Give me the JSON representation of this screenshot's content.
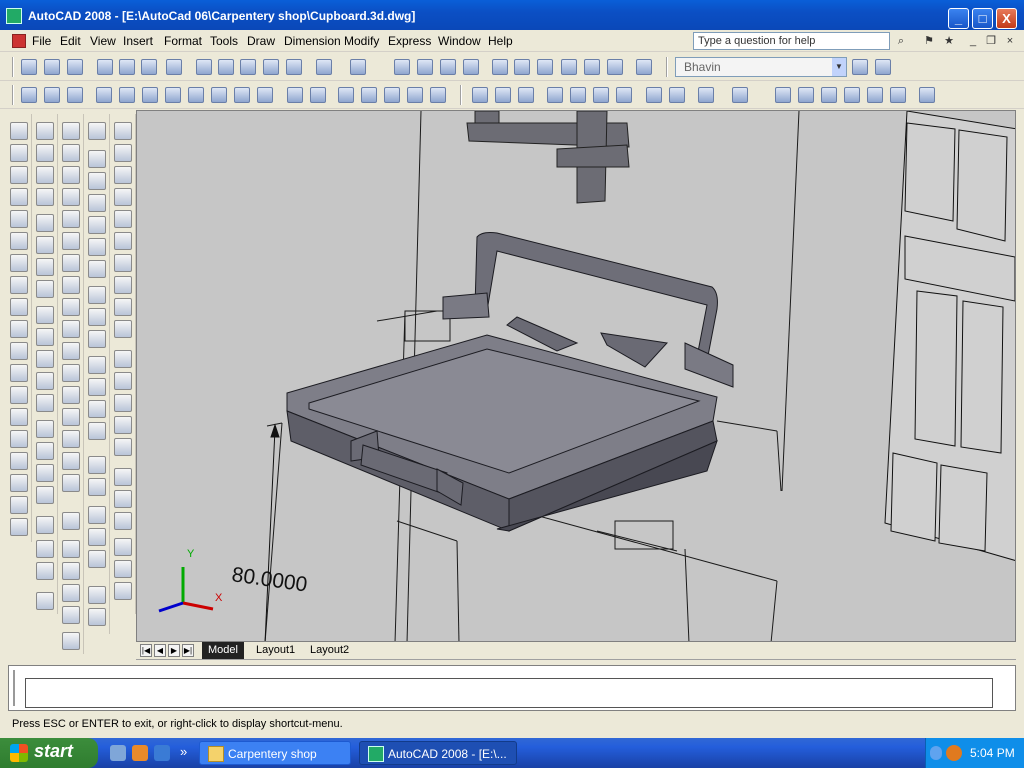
{
  "window": {
    "title": "AutoCAD 2008 - [E:\\AutoCad 06\\Carpentery shop\\Cupboard.3d.dwg]",
    "minimize_glyph": "_",
    "maximize_glyph": "□",
    "close_glyph": "X"
  },
  "menu": {
    "items": [
      "File",
      "Edit",
      "View",
      "Insert",
      "Format",
      "Tools",
      "Draw",
      "Dimension",
      "Modify",
      "Express",
      "Window",
      "Help"
    ],
    "help_placeholder": "Type a question for help"
  },
  "toolbar": {
    "workspace_combo": "Bhavin"
  },
  "canvas": {
    "dimension_label": "80.0000",
    "ucs_y": "Y",
    "ucs_x": "X"
  },
  "tabs": {
    "items": [
      "Model",
      "Layout1",
      "Layout2"
    ],
    "active": "Model"
  },
  "command": {
    "status": "Press ESC or ENTER to exit, or right-click to display shortcut-menu."
  },
  "taskbar": {
    "start_label": "start",
    "tasks": [
      "Carpentery shop",
      "AutoCAD 2008 - [E:\\..."
    ],
    "clock": "5:04 PM",
    "overflow_glyph": "»"
  }
}
